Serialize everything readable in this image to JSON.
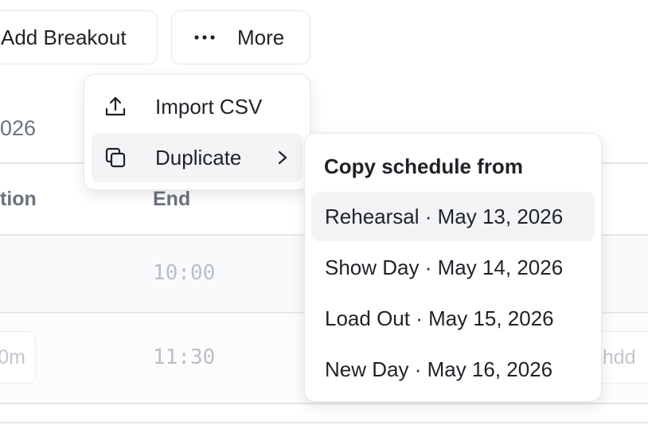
{
  "toolbar": {
    "add_breakout_label": "Add Breakout",
    "more_label": "More"
  },
  "background": {
    "date_fragment": "026",
    "col_left_header": "tion",
    "col_end_header": "End",
    "rows": [
      {
        "end": "10:00"
      },
      {
        "pill_left": "0m",
        "end": "11:30",
        "pill_right": "ghdd"
      }
    ]
  },
  "menu": {
    "items": [
      {
        "label": "Import CSV",
        "icon": "upload-icon"
      },
      {
        "label": "Duplicate",
        "icon": "copy-icon",
        "has_submenu": true
      }
    ]
  },
  "submenu": {
    "title": "Copy schedule from",
    "items": [
      {
        "label": "Rehearsal · May 13, 2026"
      },
      {
        "label": "Show Day · May 14, 2026"
      },
      {
        "label": "Load Out · May 15, 2026"
      },
      {
        "label": "New Day · May 16, 2026"
      }
    ]
  },
  "colors": {
    "text": "#1f2328",
    "muted": "#6b7280",
    "border": "#e5e7eb",
    "hover": "#f3f4f6"
  }
}
